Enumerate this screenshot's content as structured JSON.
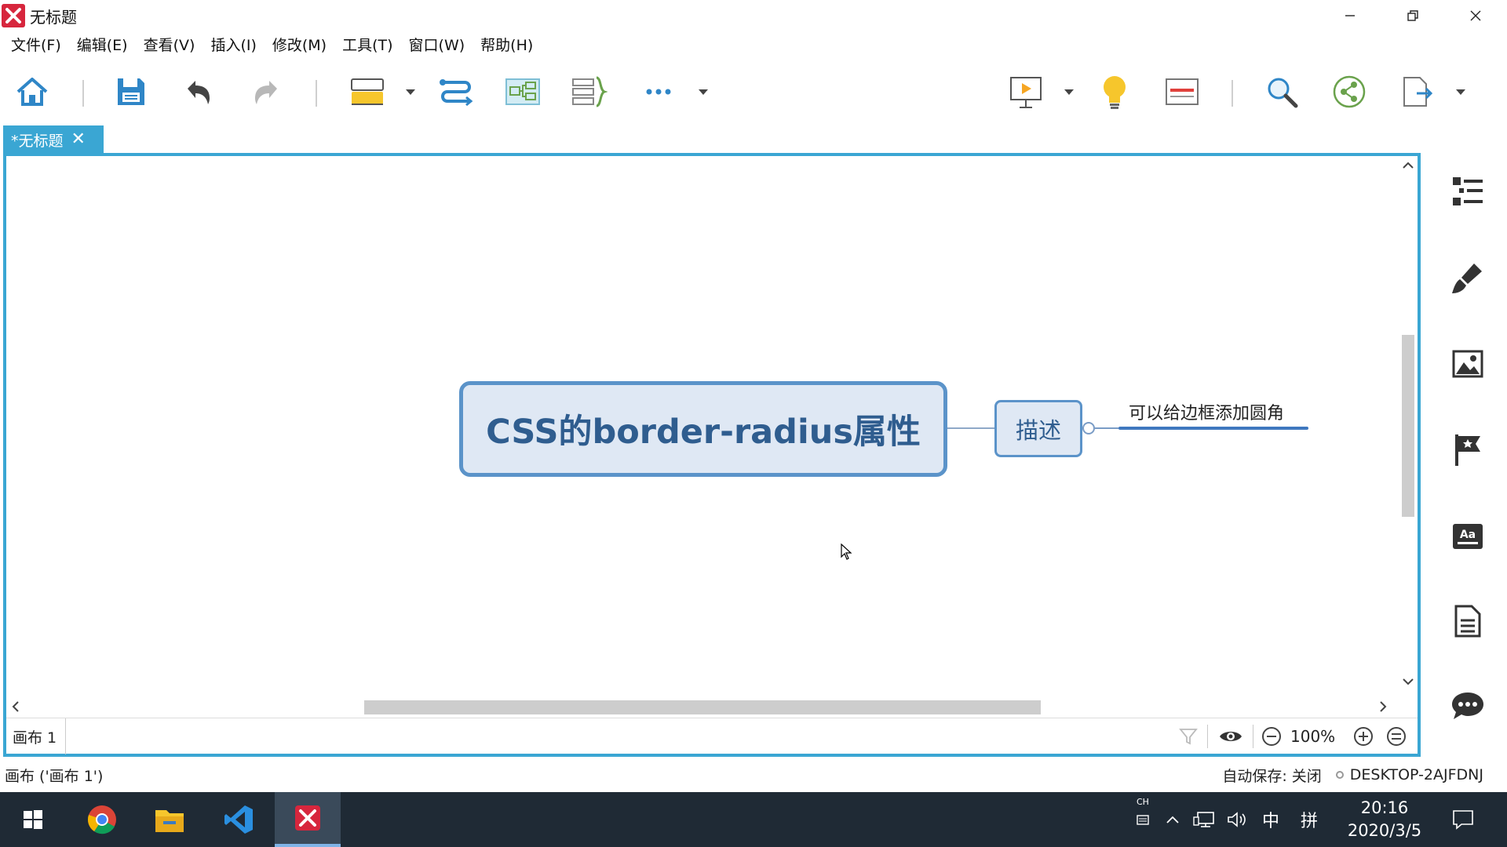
{
  "window": {
    "title": "无标题",
    "app_icon": "xmind-logo-icon"
  },
  "menu": {
    "items": [
      "文件(F)",
      "编辑(E)",
      "查看(V)",
      "插入(I)",
      "修改(M)",
      "工具(T)",
      "窗口(W)",
      "帮助(H)"
    ]
  },
  "toolbar": {
    "icons": [
      "home-icon",
      "save-icon",
      "undo-icon",
      "redo-icon",
      "topic-icon",
      "relationship-icon",
      "boundary-icon",
      "summary-icon",
      "more-icon",
      "presentation-icon",
      "idea-icon",
      "gantt-icon",
      "search-icon",
      "share-icon",
      "export-icon"
    ]
  },
  "tab": {
    "label": "*无标题",
    "close": "✕"
  },
  "mindmap": {
    "central_topic": "CSS的border-radius属性",
    "subtopic": "描述",
    "subtopic_child": "可以给边框添加圆角"
  },
  "sheetbar": {
    "sheet_name": "画布 1",
    "zoom": "100%"
  },
  "statusbar": {
    "left": "画布 ('画布 1')",
    "autosave": "自动保存: 关闭",
    "computer": "DESKTOP-2AJFDNJ"
  },
  "taskbar": {
    "ime_mode": "中",
    "ime_layout": "拼",
    "ime_top": "CH",
    "time": "20:16",
    "date": "2020/3/5"
  },
  "colors": {
    "accent": "#3aa6d3",
    "topic_border": "#5b93c9",
    "topic_fill": "#dfe8f4",
    "topic_text": "#2f5d8f",
    "taskbar": "#1f2a35"
  }
}
